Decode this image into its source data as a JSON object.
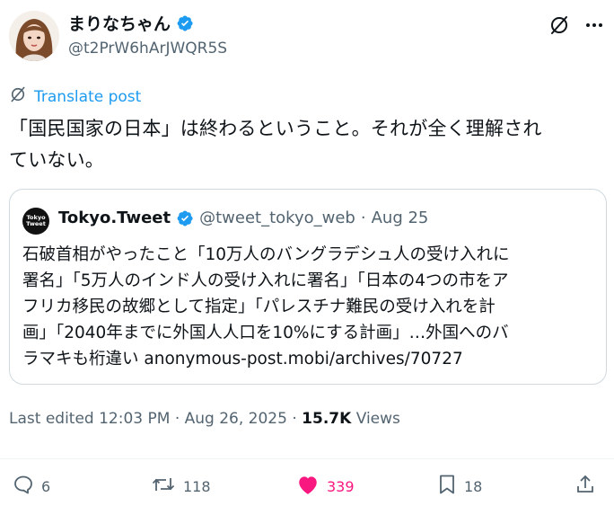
{
  "author": {
    "display_name": "まりなちゃん",
    "handle": "@t2PrW6hArJWQR5S"
  },
  "translate_label": "Translate post",
  "tweet_lines": [
    "「国民国家の日本」は終わるということ。それが全く理解され",
    "ていない。"
  ],
  "quote": {
    "avatar_lines": [
      "Tokyo",
      "Tweet"
    ],
    "name": "Tokyo.Tweet",
    "handle": "@tweet_tokyo_web",
    "separator": "·",
    "date": "Aug 25",
    "lines": [
      "石破首相がやったこと「10万人のバングラデシュ人の受け入れに",
      "署名」「5万人のインド人の受け入れに署名」「日本の4つの市をア",
      "フリカ移民の故郷として指定」「パレスチナ難民の受け入れを計",
      "画」「2040年までに外国人人口を10%にする計画」…外国へのバ",
      "ラマキも桁違い anonymous-post.mobi/archives/70727"
    ]
  },
  "meta": {
    "edited_prefix": "Last edited 12:03 PM · Aug 26, 2025 · ",
    "views_count": "15.7K",
    "views_label": "Views"
  },
  "actions": {
    "replies": "6",
    "reposts": "118",
    "likes": "339",
    "bookmarks": "18"
  },
  "colors": {
    "accent": "#1d9bf0",
    "like": "#f91880",
    "secondary_text": "#536471",
    "border": "#cfd9de"
  },
  "icons": [
    "verified-badge-icon",
    "grok-icon",
    "more-icon",
    "translate-icon",
    "reply-icon",
    "repost-icon",
    "heart-icon",
    "bookmark-icon",
    "share-icon"
  ]
}
